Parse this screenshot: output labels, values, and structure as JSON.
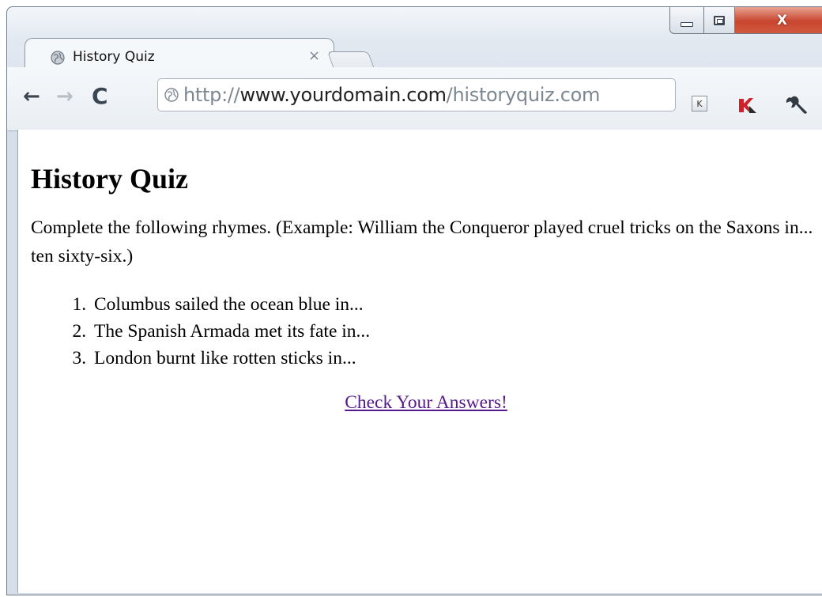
{
  "browser": {
    "tab": {
      "title": "History Quiz",
      "close_glyph": "×"
    },
    "window_controls": {
      "close_glyph": "X"
    },
    "toolbar": {
      "back_glyph": "←",
      "forward_glyph": "→",
      "reload_glyph": "C",
      "url_scheme": "http://",
      "url_host": "www.yourdomain.com",
      "url_path": "/historyquiz.com",
      "extension_k_label": "K"
    },
    "icons": [
      "globe-icon",
      "back-arrow-icon",
      "forward-arrow-icon",
      "reload-icon",
      "kaspersky-icon",
      "wrench-icon"
    ]
  },
  "page": {
    "heading": "History Quiz",
    "intro": "Complete the following rhymes. (Example: William the Conqueror played cruel tricks on the Saxons in... ten sixty-six.)",
    "questions": [
      "Columbus sailed the ocean blue in...",
      "The Spanish Armada met its fate in...",
      "London burnt like rotten sticks in..."
    ],
    "check_link": "Check Your Answers!",
    "link_color": "#551a8b"
  }
}
